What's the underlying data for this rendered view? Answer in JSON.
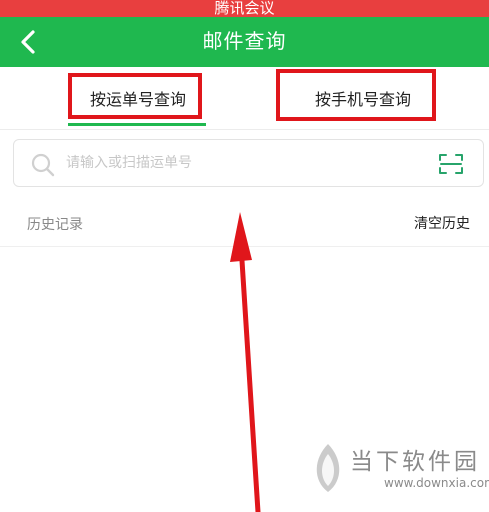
{
  "status_bar": {
    "text": "腾讯会议"
  },
  "nav": {
    "title": "邮件查询",
    "back_icon": "chevron-left-icon"
  },
  "tabs": [
    {
      "label": "按运单号查询",
      "active": true
    },
    {
      "label": "按手机号查询",
      "active": false
    }
  ],
  "search": {
    "placeholder": "请输入或扫描运单号",
    "value": "",
    "scan_icon": "scan-icon"
  },
  "history": {
    "label": "历史记录",
    "clear_label": "清空历史"
  },
  "watermark": {
    "name": "当下软件园",
    "url": "www.downxia.com"
  },
  "colors": {
    "status_bar": "#e83f3f",
    "nav_bar": "#1fb84f",
    "tab_underline": "#1fb84f",
    "highlight_box": "#e0161b",
    "annotation_arrow": "#e0161b",
    "scan_icon": "#27a46b"
  }
}
